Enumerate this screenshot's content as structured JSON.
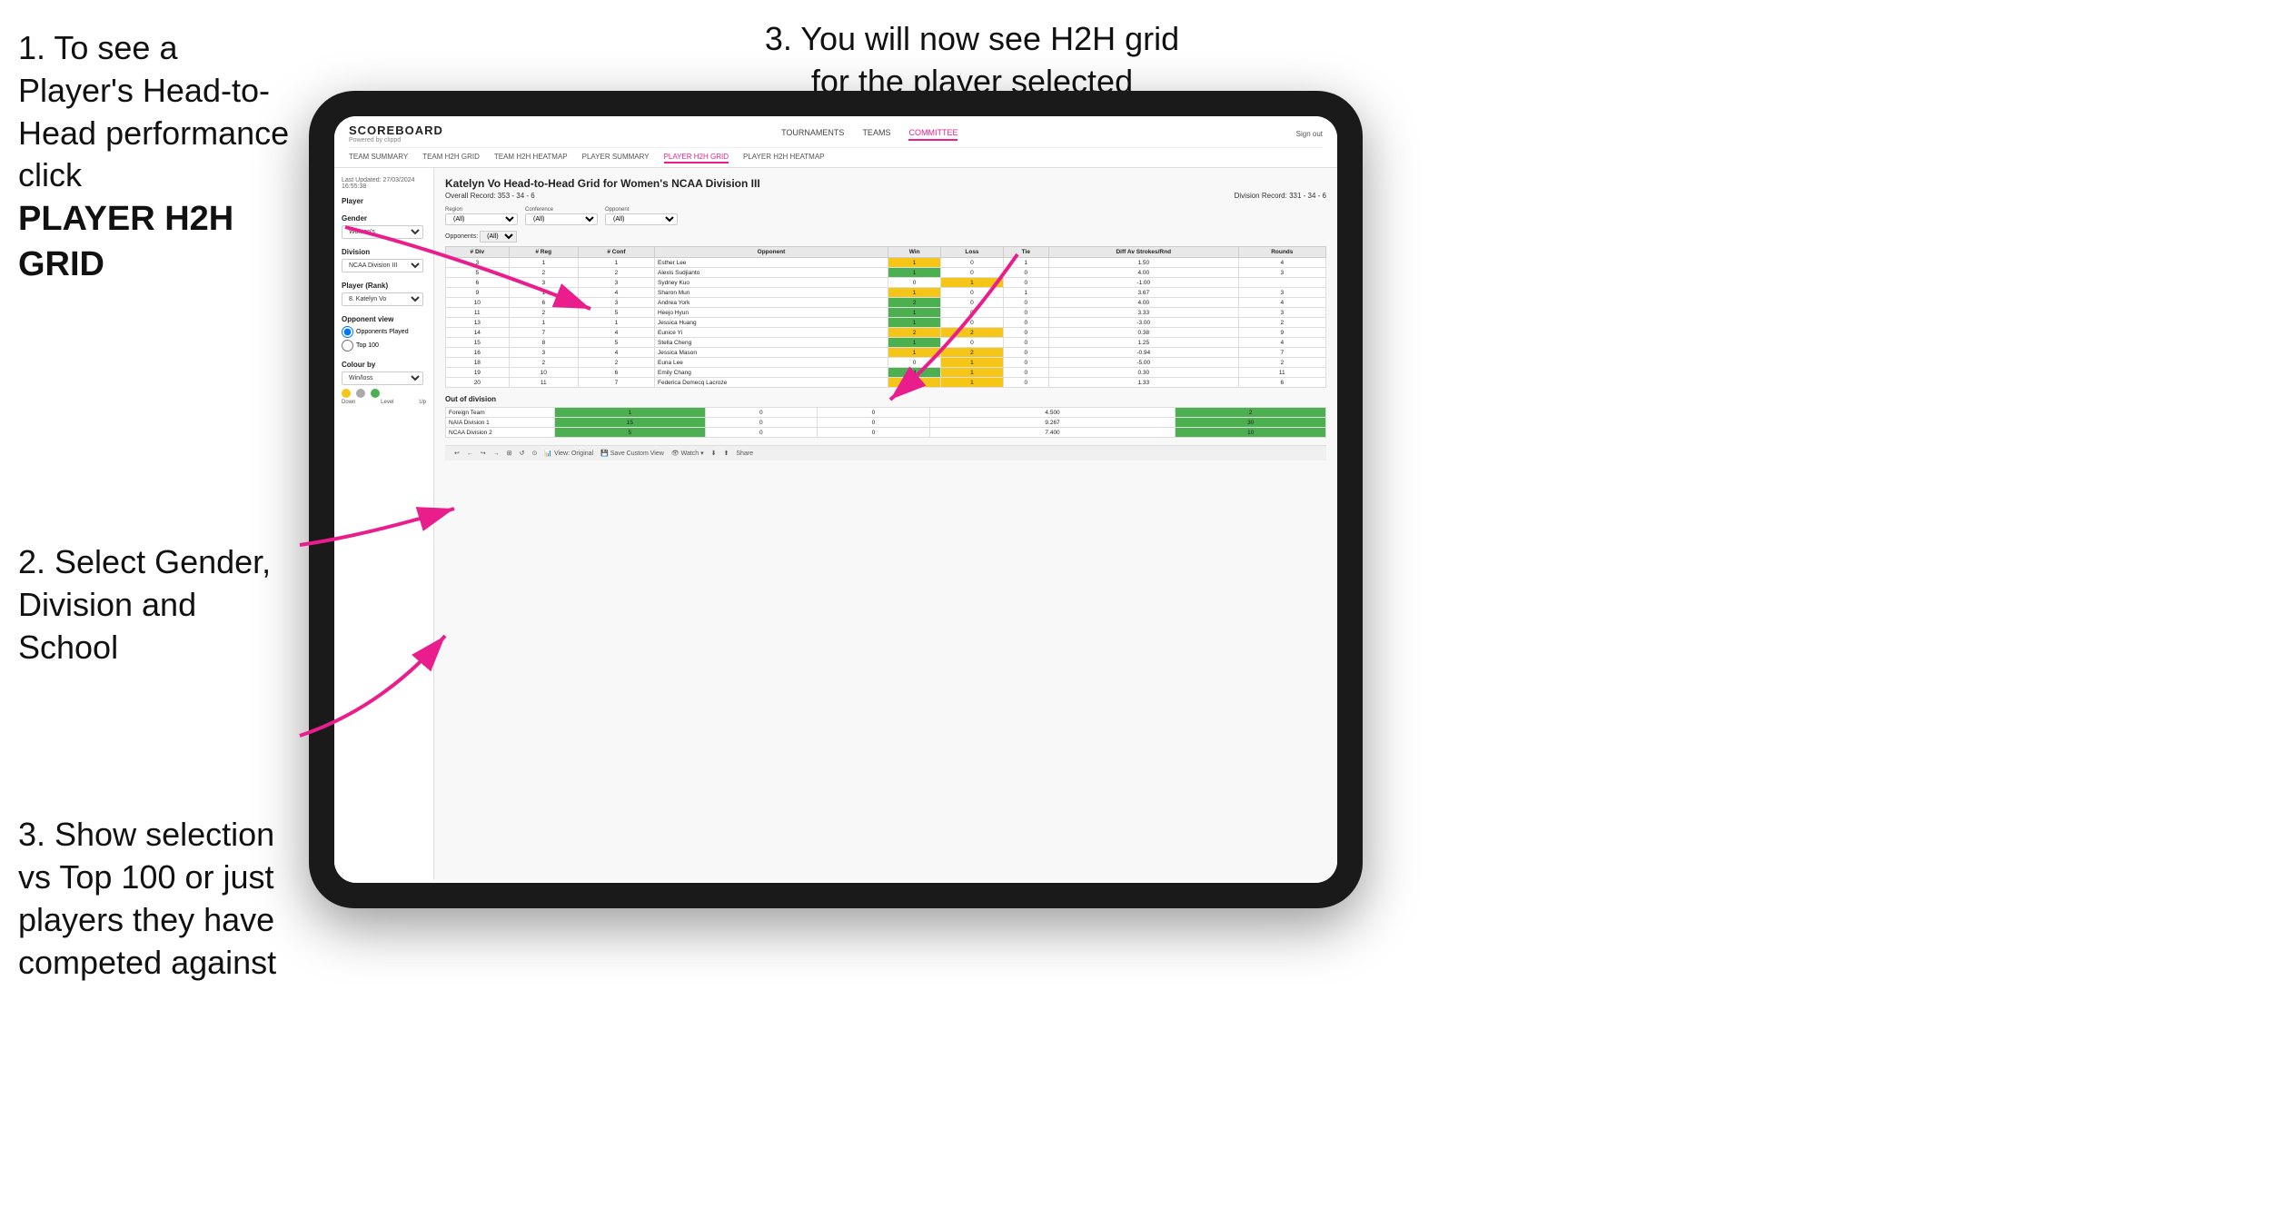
{
  "instructions": {
    "step1": "1. To see a Player's Head-to-Head performance click",
    "step1_bold": "PLAYER H2H GRID",
    "step2": "2. Select Gender, Division and School",
    "step3_left": "3. Show selection vs Top 100 or just players they have competed against",
    "step3_right_line1": "3. You will now see H2H grid",
    "step3_right_line2": "for the player selected"
  },
  "header": {
    "logo": "SCOREBOARD",
    "logo_sub": "Powered by clippd",
    "nav": [
      "TOURNAMENTS",
      "TEAMS",
      "COMMITTEE"
    ],
    "active_nav": "COMMITTEE",
    "sign_out": "Sign out",
    "sub_nav": [
      "TEAM SUMMARY",
      "TEAM H2H GRID",
      "TEAM H2H HEATMAP",
      "PLAYER SUMMARY",
      "PLAYER H2H GRID",
      "PLAYER H2H HEATMAP"
    ],
    "active_sub_nav": "PLAYER H2H GRID"
  },
  "sidebar": {
    "timestamp": "Last Updated: 27/03/2024\n16:55:38",
    "player_label": "Player",
    "gender_label": "Gender",
    "gender_value": "Women's",
    "division_label": "Division",
    "division_value": "NCAA Division III",
    "player_rank_label": "Player (Rank)",
    "player_rank_value": "8. Katelyn Vo",
    "opponent_view_label": "Opponent view",
    "opponent_view_options": [
      "Opponents Played",
      "Top 100"
    ],
    "opponent_view_selected": "Opponents Played",
    "colour_label": "Colour by",
    "colour_value": "Win/loss",
    "colour_down": "Down",
    "colour_level": "Level",
    "colour_up": "Up"
  },
  "content": {
    "title": "Katelyn Vo Head-to-Head Grid for Women's NCAA Division III",
    "overall_record": "Overall Record: 353 - 34 - 6",
    "division_record": "Division Record: 331 - 34 - 6",
    "region_label": "Region",
    "conference_label": "Conference",
    "opponent_label": "Opponent",
    "opponents_label": "Opponents:",
    "filter_all": "(All)",
    "columns": [
      "# Div",
      "# Reg",
      "# Conf",
      "Opponent",
      "Win",
      "Loss",
      "Tie",
      "Diff Av Strokes/Rnd",
      "Rounds"
    ],
    "rows": [
      {
        "div": "3",
        "reg": "1",
        "conf": "1",
        "opponent": "Esther Lee",
        "win": "1",
        "loss": "0",
        "tie": "1",
        "diff": "1.50",
        "rounds": "4",
        "win_color": "yellow",
        "loss_color": "white",
        "tie_color": "white"
      },
      {
        "div": "5",
        "reg": "2",
        "conf": "2",
        "opponent": "Alexis Sudjianto",
        "win": "1",
        "loss": "0",
        "tie": "0",
        "diff": "4.00",
        "rounds": "3",
        "win_color": "green",
        "loss_color": "white",
        "tie_color": "white"
      },
      {
        "div": "6",
        "reg": "3",
        "conf": "3",
        "opponent": "Sydney Kuo",
        "win": "0",
        "loss": "1",
        "tie": "0",
        "diff": "-1.00",
        "rounds": "",
        "win_color": "white",
        "loss_color": "yellow",
        "tie_color": "white"
      },
      {
        "div": "9",
        "reg": "1",
        "conf": "4",
        "opponent": "Sharon Mun",
        "win": "1",
        "loss": "0",
        "tie": "1",
        "diff": "3.67",
        "rounds": "3",
        "win_color": "yellow",
        "loss_color": "white",
        "tie_color": "white"
      },
      {
        "div": "10",
        "reg": "6",
        "conf": "3",
        "opponent": "Andrea York",
        "win": "2",
        "loss": "0",
        "tie": "0",
        "diff": "4.00",
        "rounds": "4",
        "win_color": "green",
        "loss_color": "white",
        "tie_color": "white"
      },
      {
        "div": "11",
        "reg": "2",
        "conf": "5",
        "opponent": "Heejo Hyun",
        "win": "1",
        "loss": "0",
        "tie": "0",
        "diff": "3.33",
        "rounds": "3",
        "win_color": "green",
        "loss_color": "white",
        "tie_color": "white"
      },
      {
        "div": "13",
        "reg": "1",
        "conf": "1",
        "opponent": "Jessica Huang",
        "win": "1",
        "loss": "0",
        "tie": "0",
        "diff": "-3.00",
        "rounds": "2",
        "win_color": "green",
        "loss_color": "white",
        "tie_color": "white"
      },
      {
        "div": "14",
        "reg": "7",
        "conf": "4",
        "opponent": "Eunice Yi",
        "win": "2",
        "loss": "2",
        "tie": "0",
        "diff": "0.38",
        "rounds": "9",
        "win_color": "yellow",
        "loss_color": "yellow",
        "tie_color": "white"
      },
      {
        "div": "15",
        "reg": "8",
        "conf": "5",
        "opponent": "Stella Cheng",
        "win": "1",
        "loss": "0",
        "tie": "0",
        "diff": "1.25",
        "rounds": "4",
        "win_color": "green",
        "loss_color": "white",
        "tie_color": "white"
      },
      {
        "div": "16",
        "reg": "3",
        "conf": "4",
        "opponent": "Jessica Mason",
        "win": "1",
        "loss": "2",
        "tie": "0",
        "diff": "-0.94",
        "rounds": "7",
        "win_color": "yellow",
        "loss_color": "yellow",
        "tie_color": "white"
      },
      {
        "div": "18",
        "reg": "2",
        "conf": "2",
        "opponent": "Euna Lee",
        "win": "0",
        "loss": "1",
        "tie": "0",
        "diff": "-5.00",
        "rounds": "2",
        "win_color": "white",
        "loss_color": "yellow",
        "tie_color": "white"
      },
      {
        "div": "19",
        "reg": "10",
        "conf": "6",
        "opponent": "Emily Chang",
        "win": "4",
        "loss": "1",
        "tie": "0",
        "diff": "0.30",
        "rounds": "11",
        "win_color": "green",
        "loss_color": "yellow",
        "tie_color": "white"
      },
      {
        "div": "20",
        "reg": "11",
        "conf": "7",
        "opponent": "Federica Domecq Lacroze",
        "win": "2",
        "loss": "1",
        "tie": "0",
        "diff": "1.33",
        "rounds": "6",
        "win_color": "yellow",
        "loss_color": "yellow",
        "tie_color": "white"
      }
    ],
    "out_of_division_label": "Out of division",
    "out_of_division_rows": [
      {
        "name": "Foreign Team",
        "win": "1",
        "loss": "0",
        "tie": "0",
        "diff": "4.500",
        "rounds": "2",
        "win_color": "green"
      },
      {
        "name": "NAIA Division 1",
        "win": "15",
        "loss": "0",
        "tie": "0",
        "diff": "9.267",
        "rounds": "30",
        "win_color": "green"
      },
      {
        "name": "NCAA Division 2",
        "win": "5",
        "loss": "0",
        "tie": "0",
        "diff": "7.400",
        "rounds": "10",
        "win_color": "green"
      }
    ]
  },
  "toolbar": {
    "buttons": [
      "↩",
      "←",
      "↪",
      "→",
      "⊞",
      "↺",
      "⊙",
      "View: Original",
      "Save Custom View",
      "👁 Watch ▾",
      "⬇",
      "⬆",
      "Share"
    ]
  }
}
